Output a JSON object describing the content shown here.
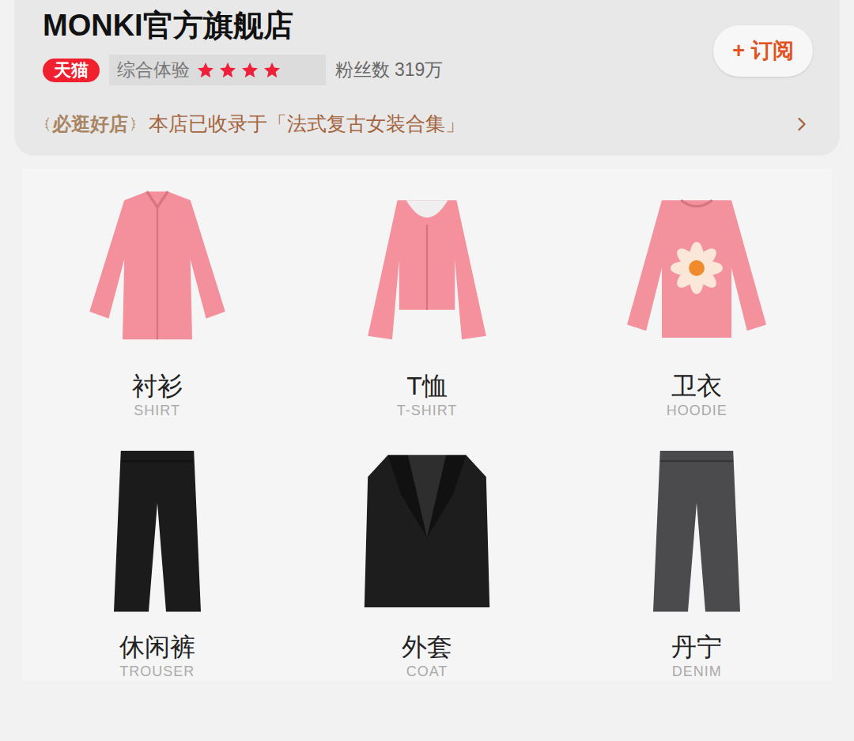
{
  "store": {
    "name": "MONKI官方旗舰店",
    "platform_badge": "天猫",
    "rating_label": "综合体验",
    "stars": 4,
    "followers_label": "粉丝数",
    "followers": "319万"
  },
  "subscribe": {
    "icon": "+",
    "label": "订阅"
  },
  "featured": {
    "badge": "必逛好店",
    "text": "本店已收录于「法式复古女装合集」"
  },
  "categories": [
    {
      "label": "衬衫",
      "label_en": "SHIRT",
      "kind": "shirt",
      "color": "#f3909b"
    },
    {
      "label": "T恤",
      "label_en": "T-SHIRT",
      "kind": "tee",
      "color": "#f4919c"
    },
    {
      "label": "卫衣",
      "label_en": "HOODIE",
      "kind": "hoodie",
      "color": "#f3929c"
    },
    {
      "label": "休闲裤",
      "label_en": "TROUSER",
      "kind": "trouser",
      "color": "#1b1b1b"
    },
    {
      "label": "外套",
      "label_en": "COAT",
      "kind": "coat",
      "color": "#1d1d1d"
    },
    {
      "label": "丹宁",
      "label_en": "DENIM",
      "kind": "denim",
      "color": "#4b4b4d"
    }
  ]
}
